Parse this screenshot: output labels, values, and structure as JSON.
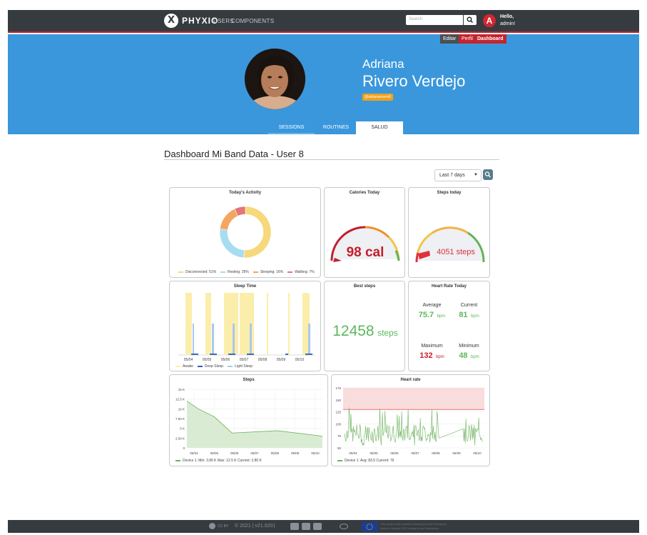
{
  "navbar": {
    "logo_mark": "X",
    "brand": "PHYXIO",
    "links": [
      "USERS",
      "COMPONENTS"
    ],
    "search_placeholder": "Search",
    "avatar_letter": "A",
    "hello": "Hello,",
    "username": "admin!"
  },
  "hero": {
    "buttons": [
      "Editar",
      "Perfil",
      "Dashboard"
    ],
    "first_name": "Adriana",
    "last_name": "Rivero Verdejo",
    "handle": "@adrianarivero6",
    "tabs": [
      "SESSIONS",
      "ROUTINES",
      "SALUD"
    ],
    "active_tab": "SALUD",
    "bg_color": "#3a97dc"
  },
  "dashboard": {
    "title": "Dashboard Mi Band Data - User 8",
    "range_value": "Last 7 days"
  },
  "activity": {
    "title": "Today's Activity",
    "chart_data": {
      "type": "pie",
      "labels": [
        "Disconnected",
        "Resting",
        "Sleeping",
        "Walking"
      ],
      "values": [
        51,
        26,
        16,
        7
      ],
      "colors": [
        "#f5d97a",
        "#a8dcef",
        "#f4a55e",
        "#e57676"
      ]
    },
    "legend": [
      "Disconnected: 51%",
      "Resting: 26%",
      "Sleeping: 16%",
      "Walking: 7%"
    ]
  },
  "calories": {
    "title": "Calories Today",
    "value_text": "98 cal",
    "gauge_fraction": 0.02
  },
  "steps_today": {
    "title": "Steps today",
    "value_text": "4051 steps",
    "gauge_fraction": 0.05
  },
  "sleep": {
    "title": "Sleep Time",
    "chart_data": {
      "type": "bar",
      "categories": [
        "05/04",
        "05/05",
        "05/06",
        "05/07",
        "05/08",
        "05/09",
        "05/10"
      ],
      "series": [
        {
          "name": "Awake",
          "color": "#fbeeaa"
        },
        {
          "name": "Deep Sleep",
          "color": "#2f5fb3"
        },
        {
          "name": "Light Sleep",
          "color": "#a9c9ec"
        }
      ]
    }
  },
  "best_steps": {
    "title": "Best steps",
    "value": "12458",
    "unit": "steps"
  },
  "heart_today": {
    "title": "Heart Rate Today",
    "average_label": "Average",
    "average_value": "75.7",
    "average_unit": "bpm",
    "current_label": "Current",
    "current_value": "81",
    "current_unit": "bpm",
    "maximum_label": "Maximum",
    "maximum_value": "132",
    "maximum_unit": "bpm",
    "minimum_label": "Minimum",
    "minimum_value": "48",
    "minimum_unit": "bpm"
  },
  "steps_chart": {
    "title": "Steps",
    "chart_data": {
      "type": "area",
      "x": [
        "05/04",
        "05/05",
        "05/06",
        "05/07",
        "05/08",
        "05/09",
        "05/10"
      ],
      "yticks": [
        "15 K",
        "12.5 K",
        "10 K",
        "7.50 K",
        "5 K",
        "2.50 K",
        "0"
      ],
      "ylim": [
        0,
        15000
      ],
      "points": [
        [
          0,
          12000
        ],
        [
          0.5,
          10000
        ],
        [
          1.2,
          8000
        ],
        [
          2,
          3800
        ],
        [
          4,
          4400
        ],
        [
          6,
          3000
        ]
      ]
    },
    "legend": "Device 1: Min: 3.80 K  Max: 12.5 K  Current: 3.80 K"
  },
  "heart_chart": {
    "title": "Heart rate",
    "chart_data": {
      "type": "line",
      "x": [
        "05/04",
        "05/05",
        "05/06",
        "05/07",
        "05/08",
        "05/09",
        "05/10"
      ],
      "yticks": [
        "175",
        "150",
        "125",
        "100",
        "75",
        "50"
      ],
      "ylim": [
        50,
        175
      ],
      "threshold": 130
    },
    "legend": "Device 1: Avg: 83.5  Current: 76"
  },
  "footer": {
    "cc": "CC BY",
    "text": "© 2021  |  v21.0201",
    "eu_line1": "This project has received funding from the European",
    "eu_line2": "Union's Horizon 2020 research and innovation"
  }
}
